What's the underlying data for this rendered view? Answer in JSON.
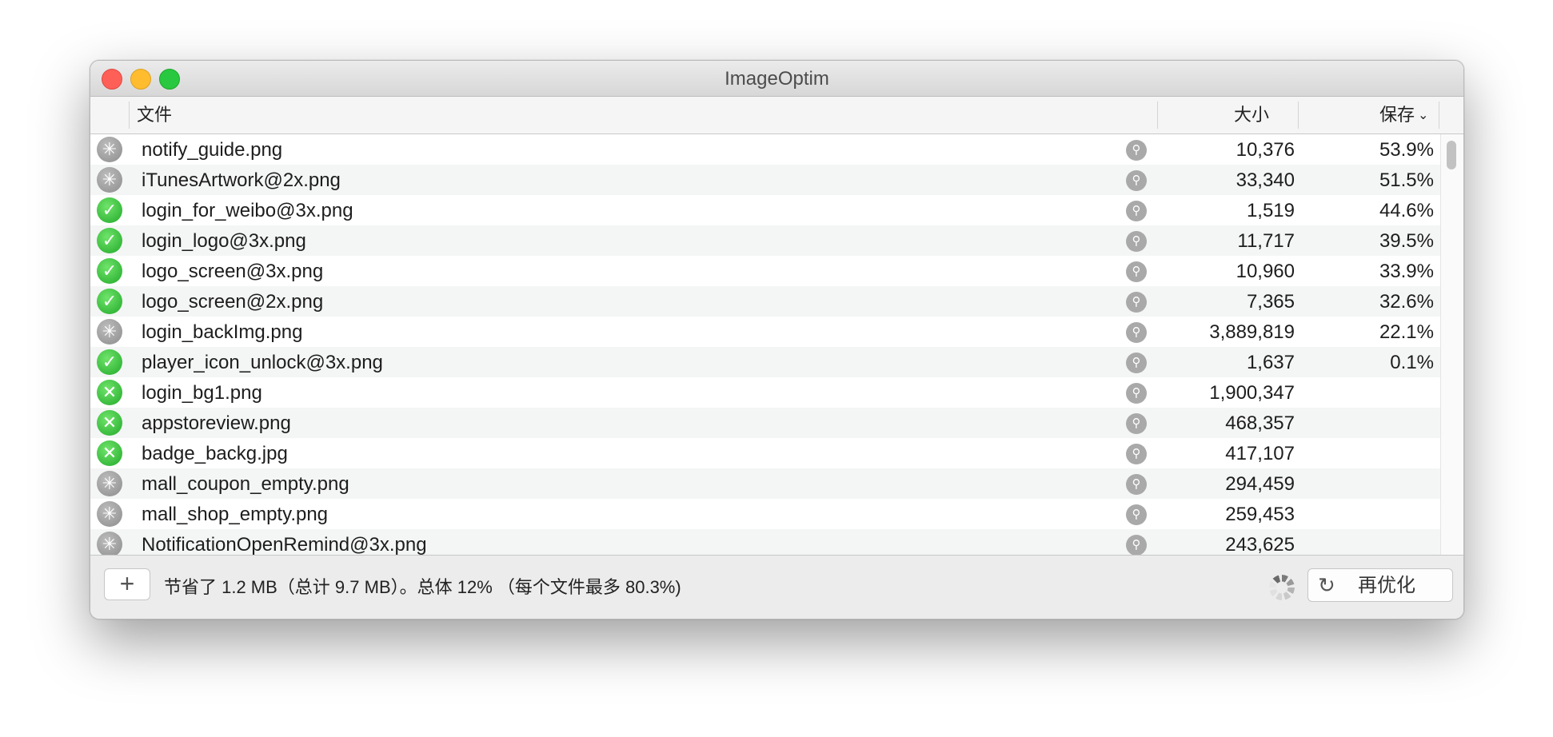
{
  "window": {
    "title": "ImageOptim"
  },
  "columns": {
    "file": "文件",
    "size": "大小",
    "saved": "保存"
  },
  "rows": [
    {
      "status": "busy",
      "file": "notify_guide.png",
      "size": "10,376",
      "saved": "53.9%"
    },
    {
      "status": "busy",
      "file": "iTunesArtwork@2x.png",
      "size": "33,340",
      "saved": "51.5%"
    },
    {
      "status": "ok",
      "file": "login_for_weibo@3x.png",
      "size": "1,519",
      "saved": "44.6%"
    },
    {
      "status": "ok",
      "file": "login_logo@3x.png",
      "size": "11,717",
      "saved": "39.5%"
    },
    {
      "status": "ok",
      "file": "logo_screen@3x.png",
      "size": "10,960",
      "saved": "33.9%"
    },
    {
      "status": "ok",
      "file": "logo_screen@2x.png",
      "size": "7,365",
      "saved": "32.6%"
    },
    {
      "status": "busy",
      "file": "login_backImg.png",
      "size": "3,889,819",
      "saved": "22.1%"
    },
    {
      "status": "ok",
      "file": "player_icon_unlock@3x.png",
      "size": "1,637",
      "saved": "0.1%"
    },
    {
      "status": "error",
      "file": "login_bg1.png",
      "size": "1,900,347",
      "saved": ""
    },
    {
      "status": "error",
      "file": "appstoreview.png",
      "size": "468,357",
      "saved": ""
    },
    {
      "status": "error",
      "file": "badge_backg.jpg",
      "size": "417,107",
      "saved": ""
    },
    {
      "status": "busy",
      "file": "mall_coupon_empty.png",
      "size": "294,459",
      "saved": ""
    },
    {
      "status": "busy",
      "file": "mall_shop_empty.png",
      "size": "259,453",
      "saved": ""
    },
    {
      "status": "busy",
      "file": "NotificationOpenRemind@3x.png",
      "size": "243,625",
      "saved": ""
    }
  ],
  "footer": {
    "add_label": "+",
    "summary": "节省了 1.2 MB（总计 9.7 MB）。总体 12% （每个文件最多 80.3%)",
    "reoptimize_label": "再优化"
  },
  "icons": {
    "status_ok": "checkmark-icon",
    "status_error": "x-circle-icon",
    "status_busy": "spinner-icon",
    "magnifier": "magnifier-icon",
    "sort": "chevron-down-icon",
    "refresh": "refresh-icon"
  },
  "colors": {
    "ok": "#2fb432",
    "busy": "#9a9a9a",
    "close": "#fe5f57",
    "minimize": "#febc2e",
    "maximize": "#28c840"
  }
}
